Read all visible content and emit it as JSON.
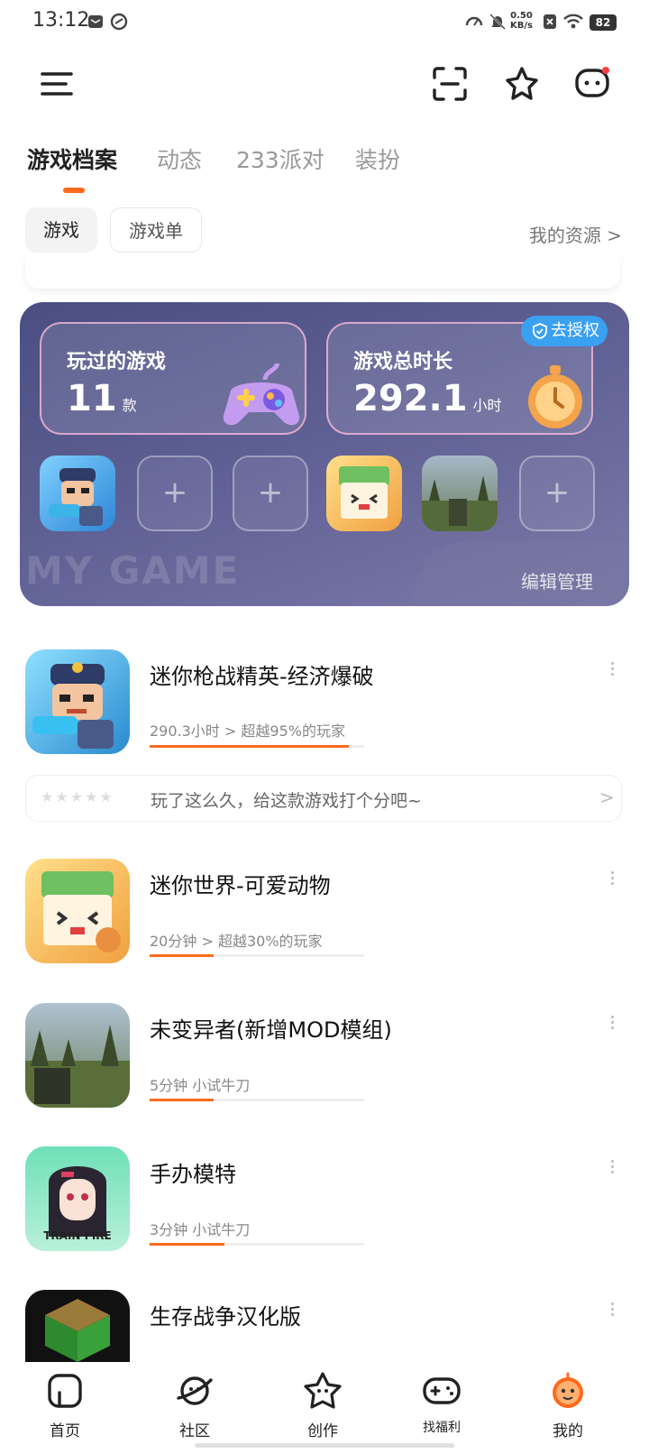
{
  "status_bar": {
    "time": "13:12",
    "net_speed_value": "0.50",
    "net_speed_unit": "KB/s",
    "battery": "82"
  },
  "header": {
    "menu_icon": "menu-icon",
    "scan_icon": "scan-icon",
    "star_icon": "star-badge-icon",
    "message_icon": "message-icon"
  },
  "tabs": [
    {
      "label": "游戏档案",
      "active": true
    },
    {
      "label": "动态",
      "active": false
    },
    {
      "label": "233派对",
      "active": false
    },
    {
      "label": "装扮",
      "active": false
    }
  ],
  "filters": {
    "games_label": "游戏",
    "gamelist_label": "游戏单",
    "my_resources": "我的资源 >"
  },
  "card": {
    "played_label": "玩过的游戏",
    "played_value": "11",
    "played_unit": "款",
    "time_label": "游戏总时长",
    "time_value": "292.1",
    "time_unit": "小时",
    "auth_label": "去授权",
    "bg_text": "MY GAME",
    "edit_label": "编辑管理",
    "plus": "+"
  },
  "games": [
    {
      "name": "迷你枪战精英-经济爆破",
      "meta": "290.3小时 > 超越95%的玩家",
      "progress": 0.93
    },
    {
      "name": "迷你世界-可爱动物",
      "meta": "20分钟 > 超越30%的玩家",
      "progress": 0.3
    },
    {
      "name": "未变异者(新增MOD模组)",
      "meta": "5分钟 小试牛刀",
      "progress": 0.3
    },
    {
      "name": "手办模特",
      "meta": "3分钟 小试牛刀",
      "progress": 0.35
    },
    {
      "name": "生存战争汉化版",
      "meta": "",
      "progress": 0
    }
  ],
  "rating": {
    "stars": "★★★★★",
    "text": "玩了这么久，给这款游戏打个分吧~",
    "chevron": ">"
  },
  "icon_text": {
    "train_fire": "TRAIN FIRE"
  },
  "nav": [
    {
      "label": "首页",
      "icon": "home-icon"
    },
    {
      "label": "社区",
      "icon": "planet-icon"
    },
    {
      "label": "创作",
      "icon": "star-face-icon"
    },
    {
      "label": "找福利",
      "icon": "gamepad-icon"
    },
    {
      "label": "我的",
      "icon": "avatar-icon",
      "active": true
    }
  ],
  "colors": {
    "accent": "#ff6a1a",
    "card": "#54588a",
    "auth": "#3aa0f0"
  }
}
